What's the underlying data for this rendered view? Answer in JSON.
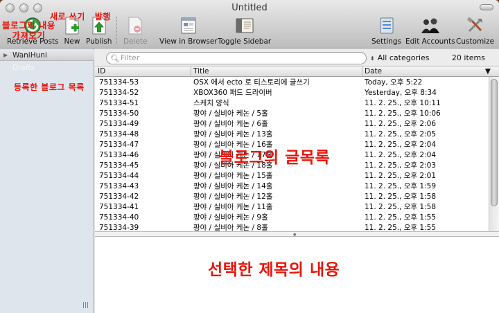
{
  "window": {
    "title": "Untitled"
  },
  "toolbar": {
    "retrieve_label": "Retrieve Posts",
    "new_label": "New",
    "publish_label": "Publish",
    "delete_label": "Delete",
    "view_browser_label": "View in Browser",
    "toggle_sidebar_label": "Toggle Sidebar",
    "settings_label": "Settings",
    "edit_accounts_label": "Edit Accounts",
    "customize_label": "Customize"
  },
  "sidebar": {
    "account": "WaniHuni",
    "drafts": "Drafts",
    "grip": "|||"
  },
  "filter": {
    "placeholder": "Filter",
    "category": "All categories",
    "count": "20 items"
  },
  "columns": {
    "id": "ID",
    "title": "Title",
    "date": "Date"
  },
  "posts": [
    {
      "id": "751334-53",
      "title": "OSX 에서 ecto 로 티스토리에 글쓰기",
      "date": "Today, 오후 5:22"
    },
    {
      "id": "751334-52",
      "title": "XBOX360 패드 드라이버",
      "date": "Yesterday, 오후 8:34"
    },
    {
      "id": "751334-51",
      "title": "스케치 양식",
      "date": "11. 2. 25., 오후 10:11"
    },
    {
      "id": "751334-50",
      "title": "팡야 / 실비아 케논 / 5홀",
      "date": "11. 2. 25., 오후 10:06"
    },
    {
      "id": "751334-49",
      "title": "팡야 / 실비아 케논 / 6홀",
      "date": "11. 2. 25., 오후 2:06"
    },
    {
      "id": "751334-48",
      "title": "팡야 / 실비아 케논 / 13홀",
      "date": "11. 2. 25., 오후 2:05"
    },
    {
      "id": "751334-47",
      "title": "팡야 / 실비아 케논 / 16홀",
      "date": "11. 2. 25., 오후 2:04"
    },
    {
      "id": "751334-46",
      "title": "팡야 / 실비아 케논 / 17홀",
      "date": "11. 2. 25., 오후 2:04"
    },
    {
      "id": "751334-45",
      "title": "팡야 / 실비아 케논 / 18홀",
      "date": "11. 2. 25., 오후 2:03"
    },
    {
      "id": "751334-44",
      "title": "팡야 / 실비아 케논 / 15홀",
      "date": "11. 2. 25., 오후 2:01"
    },
    {
      "id": "751334-43",
      "title": "팡야 / 실비아 케논 / 14홀",
      "date": "11. 2. 25., 오후 1:59"
    },
    {
      "id": "751334-42",
      "title": "팡야 / 실비아 케논 / 12홀",
      "date": "11. 2. 25., 오후 1:58"
    },
    {
      "id": "751334-41",
      "title": "팡야 / 실비아 케논 / 11홀",
      "date": "11. 2. 25., 오후 1:58"
    },
    {
      "id": "751334-40",
      "title": "팡야 / 실비아 케논 / 9홀",
      "date": "11. 2. 25., 오후 1:55"
    },
    {
      "id": "751334-39",
      "title": "팡야 / 실비아 케논 / 8홀",
      "date": "11. 2. 25., 오후 1:55"
    }
  ],
  "annotations": {
    "retrieve": "블로그의 내용\n가져오기",
    "new_publish": "새로 쓰기   발행",
    "blog_list": "등록한 블로그 목록",
    "post_list": "블로그의 글목록",
    "selected": "선택한 제목의 내용"
  },
  "colors": {
    "annotation": "#e8140a",
    "sidebar_bg": "#dfe5ec"
  },
  "icons": {
    "retrieve": "retrieve-icon",
    "new": "new-document-icon",
    "publish": "publish-icon",
    "delete": "delete-icon",
    "browser": "browser-icon",
    "sidebar": "sidebar-icon",
    "settings": "settings-icon",
    "accounts": "accounts-icon",
    "customize": "tools-icon"
  }
}
